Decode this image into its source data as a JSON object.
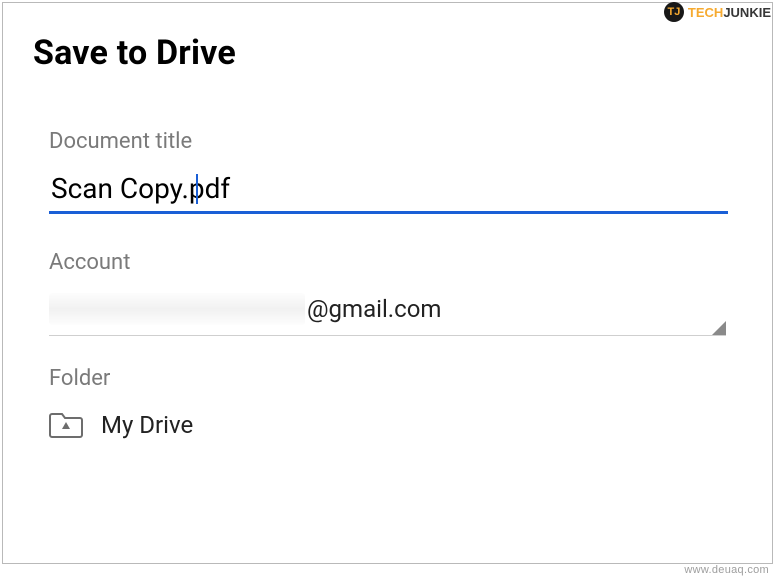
{
  "header": {
    "title": "Save to Drive"
  },
  "document_title": {
    "label": "Document title",
    "value": "Scan Copy.pdf"
  },
  "account": {
    "label": "Account",
    "domain_suffix": "@gmail.com"
  },
  "folder": {
    "label": "Folder",
    "value": "My Drive",
    "icon": "drive-folder-icon"
  },
  "branding": {
    "badge_text": "TJ",
    "name_part_a": "TECH",
    "name_part_b": "JUNKIE",
    "source_url_text": "www.deuaq.com"
  }
}
